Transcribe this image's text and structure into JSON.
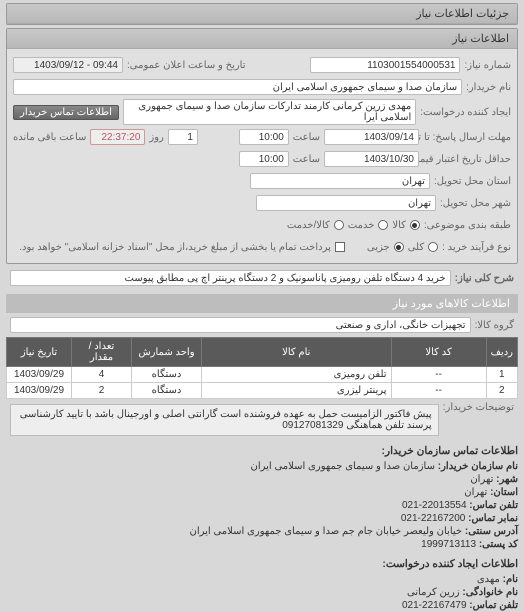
{
  "panel": {
    "title": "جزئیات اطلاعات نیاز"
  },
  "info": {
    "header": "اطلاعات نیاز",
    "req_no_label": "شماره نیاز:",
    "req_no": "1103001554000531",
    "announce_label": "تاریخ و ساعت اعلان عمومی:",
    "announce": "09:44 - 1403/09/12",
    "buyer_name_label": "نام خریدار:",
    "buyer_name": "سازمان صدا و سیمای جمهوری اسلامی ایران",
    "creator_label": "ایجاد کننده درخواست:",
    "creator": "مهدی زرین کرمانی کارمند تدارکات سازمان صدا و سیمای جمهوری اسلامی ایرا",
    "contact_btn": "اطلاعات تماس خریدار",
    "deadline_label": "مهلت ارسال پاسخ: تا تاریخ:",
    "deadline_date": "1403/09/14",
    "time_label": "ساعت",
    "deadline_time": "10:00",
    "days_label": "روز",
    "days": "1",
    "remain_label": "ساعت باقی مانده",
    "remain": "22:37:20",
    "min_valid_label": "حداقل تاریخ اعتبار قیمت: تا تاریخ:",
    "valid_date": "1403/10/30",
    "valid_time": "10:00",
    "province_label": "استان محل تحویل:",
    "province": "تهران",
    "city_label": "شهر محل تحویل:",
    "city": "تهران",
    "priority_label": "طبقه بندی موضوعی:",
    "opt_merch": "کالا",
    "opt_serv": "خدمت",
    "opt_both": "کالا/خدمت",
    "opt2_label": "نوع فرآیند خرید :",
    "opt2_all": "کلی",
    "opt2_part": "جزیی",
    "opt2_note": "پرداخت تمام یا بخشی از مبلغ خرید،از محل \"اسناد خزانه اسلامی\" خواهد بود.",
    "desc_label": "شرح کلی نیاز:",
    "desc": "خرید 4 دستگاه تلفن رومیزی پاناسونیک و 2 دستگاه پرینتر اچ پی مطابق پیوست"
  },
  "goods": {
    "header": "اطلاعات کالاهای مورد نیاز",
    "group_label": "گروه کالا:",
    "group": "تجهیزات خانگی، اداری و صنعتی",
    "cols": [
      "ردیف",
      "کد کالا",
      "نام کالا",
      "واحد شمارش",
      "تعداد / مقدار",
      "تاریخ نیاز"
    ],
    "rows": [
      {
        "n": "1",
        "code": "--",
        "name": "تلفن رومیزی",
        "unit": "دستگاه",
        "qty": "4",
        "date": "1403/09/29"
      },
      {
        "n": "2",
        "code": "--",
        "name": "پرینتر لیزری",
        "unit": "دستگاه",
        "qty": "2",
        "date": "1403/09/29"
      }
    ],
    "buyer_note_label": "توضیحات خریدار:",
    "buyer_note": "پیش فاکتور الزامیست حمل به عهده فروشنده است گارانتی اصلی و اورجینال باشد با تایید کارشناسی پرسند تلفن هماهنگی 09127081329"
  },
  "contact1": {
    "header": "اطلاعات تماس سازمان خریدار:",
    "org_label": "نام سازمان خریدار:",
    "org": "سازمان صدا و سیمای جمهوری اسلامی ایران",
    "city_label": "شهر:",
    "city": "تهران",
    "prov_label": "استان:",
    "prov": "تهران",
    "tel_label": "تلفن تماس:",
    "tel": "22013554-021",
    "fax_label": "نمابر تماس:",
    "fax": "22167200-021",
    "addr_label": "آدرس سنتی:",
    "addr": "خیابان ولیعصر خیابان جام جم صدا و سیمای جمهوری اسلامی ایران",
    "post_label": "کد پستی:",
    "post": "1999713113"
  },
  "contact2": {
    "header": "اطلاعات ایجاد کننده درخواست:",
    "name_label": "نام:",
    "name": "مهدی",
    "lname_label": "نام خانوادگی:",
    "lname": "زرین کرمانی",
    "tel_label": "تلفن تماس:",
    "tel": "22167479-021"
  }
}
